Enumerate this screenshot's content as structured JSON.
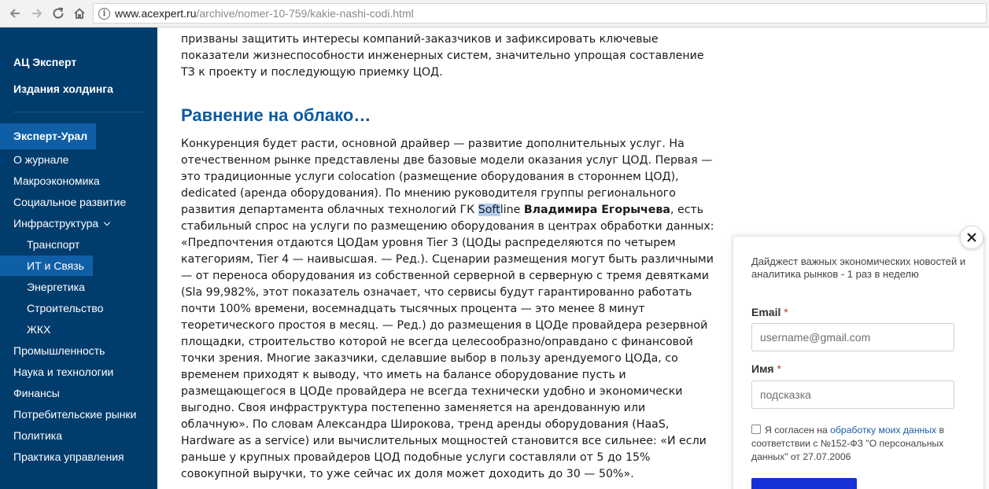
{
  "browser": {
    "url_host": "www.acexpert.ru",
    "url_path": "/archive/nomer-10-759/kakie-nashi-codi.html"
  },
  "sidebar": {
    "top_links": [
      "АЦ Эксперт",
      "Издания холдинга"
    ],
    "brand_item": "Эксперт-Урал",
    "items": [
      {
        "label": "О журнале",
        "sub": false,
        "active": false
      },
      {
        "label": "Макроэкономика",
        "sub": false,
        "active": false
      },
      {
        "label": "Социальное развитие",
        "sub": false,
        "active": false
      },
      {
        "label": "Инфраструктура",
        "sub": false,
        "active": false,
        "expanded": true
      },
      {
        "label": "Транспорт",
        "sub": true,
        "active": false
      },
      {
        "label": "ИТ и Связь",
        "sub": true,
        "active": true
      },
      {
        "label": "Энергетика",
        "sub": true,
        "active": false
      },
      {
        "label": "Строительство",
        "sub": true,
        "active": false
      },
      {
        "label": "ЖКХ",
        "sub": true,
        "active": false
      },
      {
        "label": "Промышленность",
        "sub": false,
        "active": false
      },
      {
        "label": "Наука и технологии",
        "sub": false,
        "active": false
      },
      {
        "label": "Финансы",
        "sub": false,
        "active": false
      },
      {
        "label": "Потребительские рынки",
        "sub": false,
        "active": false
      },
      {
        "label": "Политика",
        "sub": false,
        "active": false
      },
      {
        "label": "Практика управления",
        "sub": false,
        "active": false
      }
    ]
  },
  "article": {
    "para1": "призваны защитить интересы компаний-заказчиков и зафиксировать ключевые показатели жизнеспособности инженерных систем, значительно упрощая составление ТЗ к проекту и последующую приемку ЦОД.",
    "heading": "Равнение на облако…",
    "para2_a": "Конкуренция будет расти, основной драйвер — развитие дополнительных услуг. На отечественном рынке представлены две базовые модели оказания услуг ЦОД. Первая — это традиционные услуги colocation (размещение оборудования в стороннем ЦОД), dedicated (аренда оборудования). По мнению руководителя группы регионального развития департамента облачных технологий ГК ",
    "para2_hl": "Soft",
    "para2_b": "line ",
    "para2_bold": "Владимира Егорычева",
    "para2_c": ", есть стабильный спрос на услуги по размещению оборудования в центрах обработки данных: «Предпочтения отдаются ЦОДам уровня Tier 3 (ЦОДы распределяются по четырем категориям, Tier 4 — наивысшая. — Ред.). Сценарии размещения могут быть различными — от переноса оборудования из собственной серверной в серверную с тремя девятками (Sla 99,982%, этот показатель означает, что сервисы будут гарантированно работать почти 100% времени, восемнадцать тысячных процента — это менее 8 минут теоретического простоя в месяц. — Ред.) до размещения в ЦОДе провайдера резервной площадки, строительство которой не всегда целесообразно/оправдано с финансовой точки зрения. Многие заказчики, сделавшие выбор в пользу арендуемого ЦОДа, со временем приходят к выводу, что иметь на балансе оборудование пусть и размещающегося в ЦОДе провайдера не всегда технически удобно и экономически выгодно. Своя инфраструктура постепенно заменяется на арендованную или облачную». По словам Александра Широкова, тренд аренды оборудования (HaaS, Hardware as a service) или вычислительных мощностей становится все сильнее: «И если раньше у крупных провайдеров ЦОД подобные услуги составляли от 5 до 15% совокупной выручки, то уже сейчас их доля может доходить до 30 — 50%»."
  },
  "popup": {
    "description": "Дайджест важных экономических новостей и аналитика рынков - 1 раз в неделю",
    "email_label": "Email",
    "email_placeholder": "username@gmail.com",
    "name_label": "Имя",
    "name_placeholder": "подсказка",
    "required_mark": "*",
    "consent_a": "Я согласен на ",
    "consent_link": "обработку моих данных",
    "consent_b": " в соответствии с №152-ФЗ \"О персональных данных\" от 27.07.2006"
  },
  "colors": {
    "sidebar_bg": "#003c6c",
    "sidebar_active": "#0f5fa6",
    "heading": "#0c5aa0",
    "link": "#1a5fa8",
    "submit": "#1432d8"
  }
}
